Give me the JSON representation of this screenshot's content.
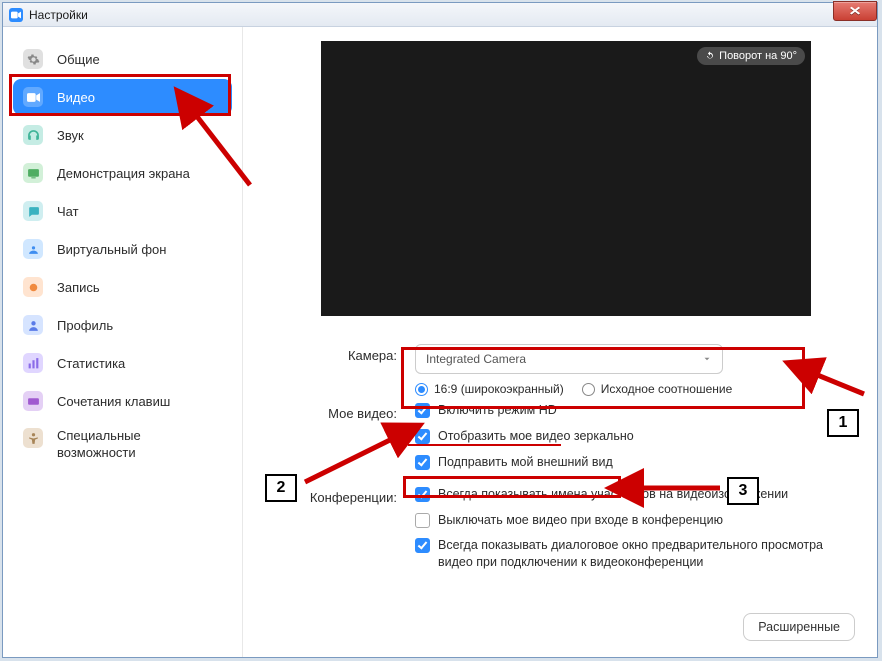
{
  "window": {
    "title": "Настройки"
  },
  "sidebar": {
    "items": [
      {
        "label": "Общие"
      },
      {
        "label": "Видео"
      },
      {
        "label": "Звук"
      },
      {
        "label": "Демонстрация экрана"
      },
      {
        "label": "Чат"
      },
      {
        "label": "Виртуальный фон"
      },
      {
        "label": "Запись"
      },
      {
        "label": "Профиль"
      },
      {
        "label": "Статистика"
      },
      {
        "label": "Сочетания клавиш"
      },
      {
        "label": "Специальные возможности"
      }
    ]
  },
  "preview": {
    "rotate": "Поворот на 90°"
  },
  "labels": {
    "camera": "Камера:",
    "my_video": "Мое видео:",
    "meetings": "Конференции:"
  },
  "camera": {
    "selected": "Integrated Camera",
    "aspect_wide": "16:9 (широкоэкранный)",
    "aspect_orig": "Исходное соотношение"
  },
  "my_video": {
    "hd": "Включить режим HD",
    "mirror": "Отобразить мое видео зеркально",
    "touch_up": "Подправить мой внешний вид"
  },
  "meetings": {
    "show_names": "Всегда показывать имена участников на видеоизображении",
    "off_on_join": "Выключать мое видео при входе в конференцию",
    "preview_dialog": "Всегда показывать диалоговое окно предварительного просмотра видео при подключении к видеоконференции"
  },
  "buttons": {
    "advanced": "Расширенные"
  },
  "anno": {
    "n1": "1",
    "n2": "2",
    "n3": "3"
  }
}
